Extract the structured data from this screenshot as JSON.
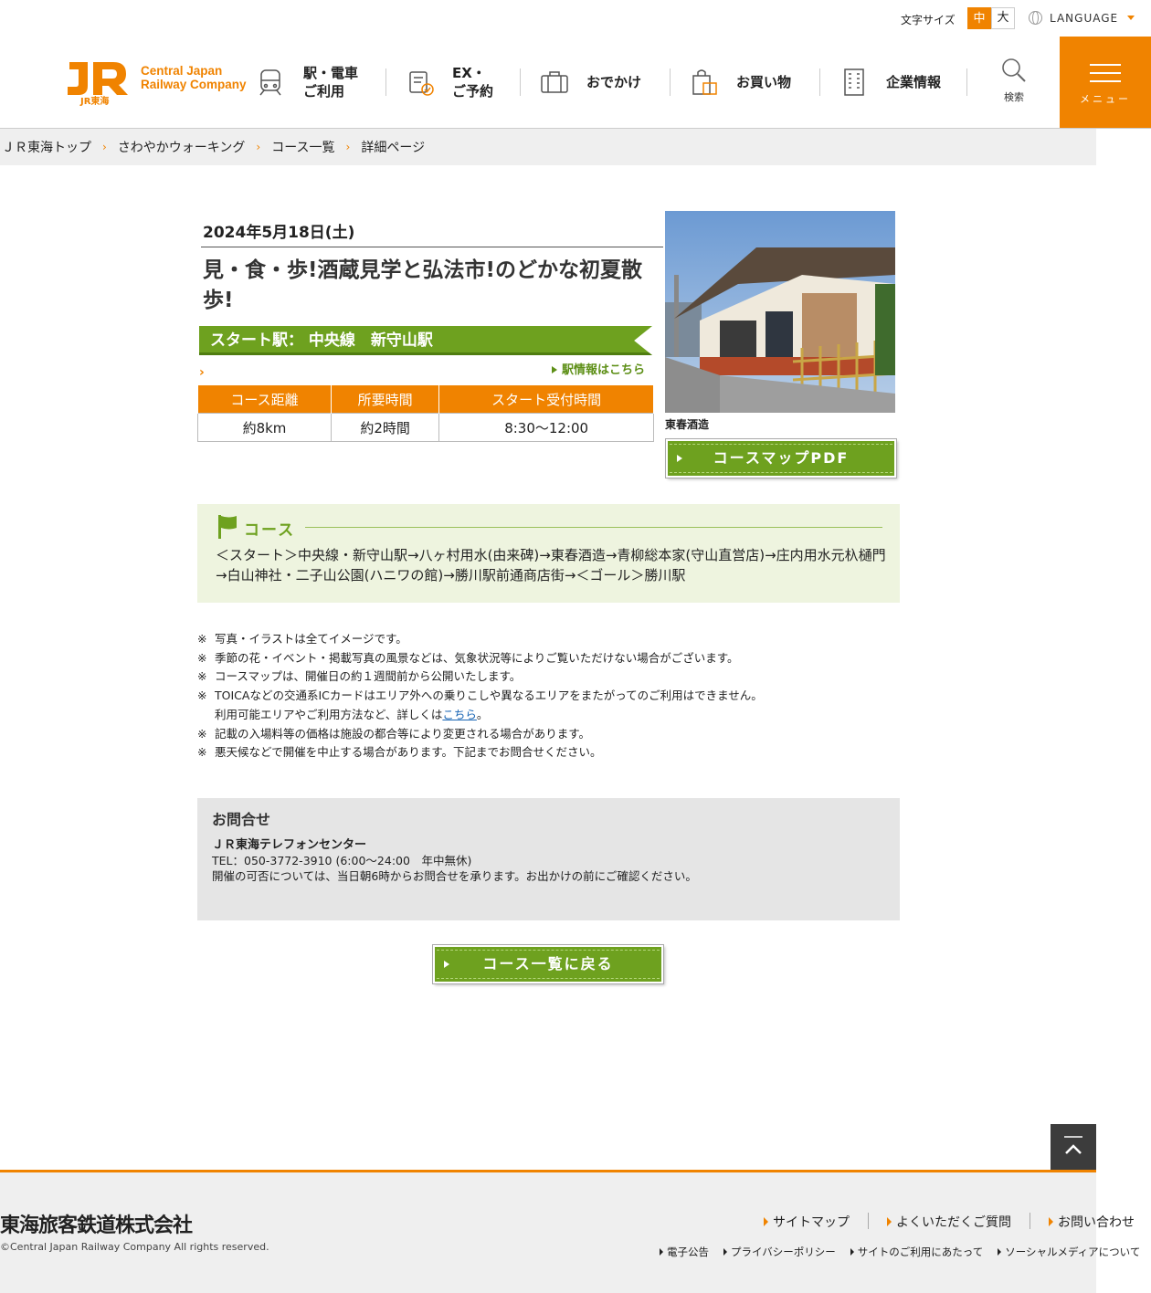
{
  "util": {
    "font_size_label": "文字サイズ",
    "font_mid": "中",
    "font_big": "大",
    "language": "LANGUAGE"
  },
  "header": {
    "logo_en_line1": "Central Japan",
    "logo_en_line2": "Railway Company",
    "logo_mark_text": "JR東海",
    "nav": [
      {
        "label": "駅・電車\nご利用",
        "icon": "train-icon"
      },
      {
        "label": "EX・\nご予約",
        "icon": "reservation-icon"
      },
      {
        "label": "おでかけ",
        "icon": "suitcase-icon"
      },
      {
        "label": "お買い物",
        "icon": "shopping-bag-icon"
      },
      {
        "label": "企業情報",
        "icon": "building-icon"
      }
    ],
    "search_label": "検索",
    "menu_label": "メニュー"
  },
  "breadcrumb": [
    "ＪＲ東海トップ",
    "さわやかウォーキング",
    "コース一覧",
    "詳細ページ"
  ],
  "event": {
    "date": "2024年5月18日(土)",
    "title": "見・食・歩!酒蔵見学と弘法市!のどかな初夏散歩!",
    "start_station": "スタート駅：  中央線　新守山駅",
    "station_link": "駅情報はこちら",
    "table_headers": [
      "コース距離",
      "所要時間",
      "スタート受付時間"
    ],
    "table_values": [
      "約8km",
      "約2時間",
      "8:30～12:00"
    ],
    "photo_caption": "東春酒造",
    "pdf_button": "コースマップPDF"
  },
  "course": {
    "title": "コース",
    "text": "＜スタート＞中央線・新守山駅→八ヶ村用水(由来碑)→東春酒造→青柳総本家(守山直営店)→庄内用水元杁樋門→白山神社・二子山公園(ハニワの館)→勝川駅前通商店街→＜ゴール＞勝川駅"
  },
  "notes": {
    "mark": "※",
    "items": [
      "写真・イラストは全てイメージです。",
      "季節の花・イベント・掲載写真の風景などは、気象状況等によりご覧いただけない場合がございます。",
      "コースマップは、開催日の約１週間前から公開いたします。",
      "TOICAなどの交通系ICカードはエリア外への乗りこしや異なるエリアをまたがってのご利用はできません。",
      "記載の入場料等の価格は施設の都合等により変更される場合があります。",
      "悪天候などで開催を中止する場合があります。下記までお問合せください。"
    ],
    "toica_cont_prefix": "利用可能エリアやご利用方法など、詳しくは",
    "toica_link": "こちら",
    "toica_cont_suffix": "。"
  },
  "contact": {
    "title": "お問合せ",
    "name": "ＪＲ東海テレフォンセンター",
    "tel": "TEL：050-3772-3910 (6:00～24:00　年中無休)",
    "note": "開催の可否については、当日朝6時からお問合せを承ります。お出かけの前にご確認ください。"
  },
  "back_button": "コース一覧に戻る",
  "footer": {
    "corp": "東海旅客鉄道株式会社",
    "copyright": "©Central Japan Railway Company All rights reserved.",
    "nav1": [
      "サイトマップ",
      "よくいただくご質問",
      "お問い合わせ"
    ],
    "nav2": [
      "電子公告",
      "プライバシーポリシー",
      "サイトのご利用にあたって",
      "ソーシャルメディアについて"
    ]
  },
  "colors": {
    "brand_orange": "#f08300",
    "course_green": "#6ea11f",
    "course_bg": "#eef4df",
    "contact_bg": "#e5e5e5"
  }
}
